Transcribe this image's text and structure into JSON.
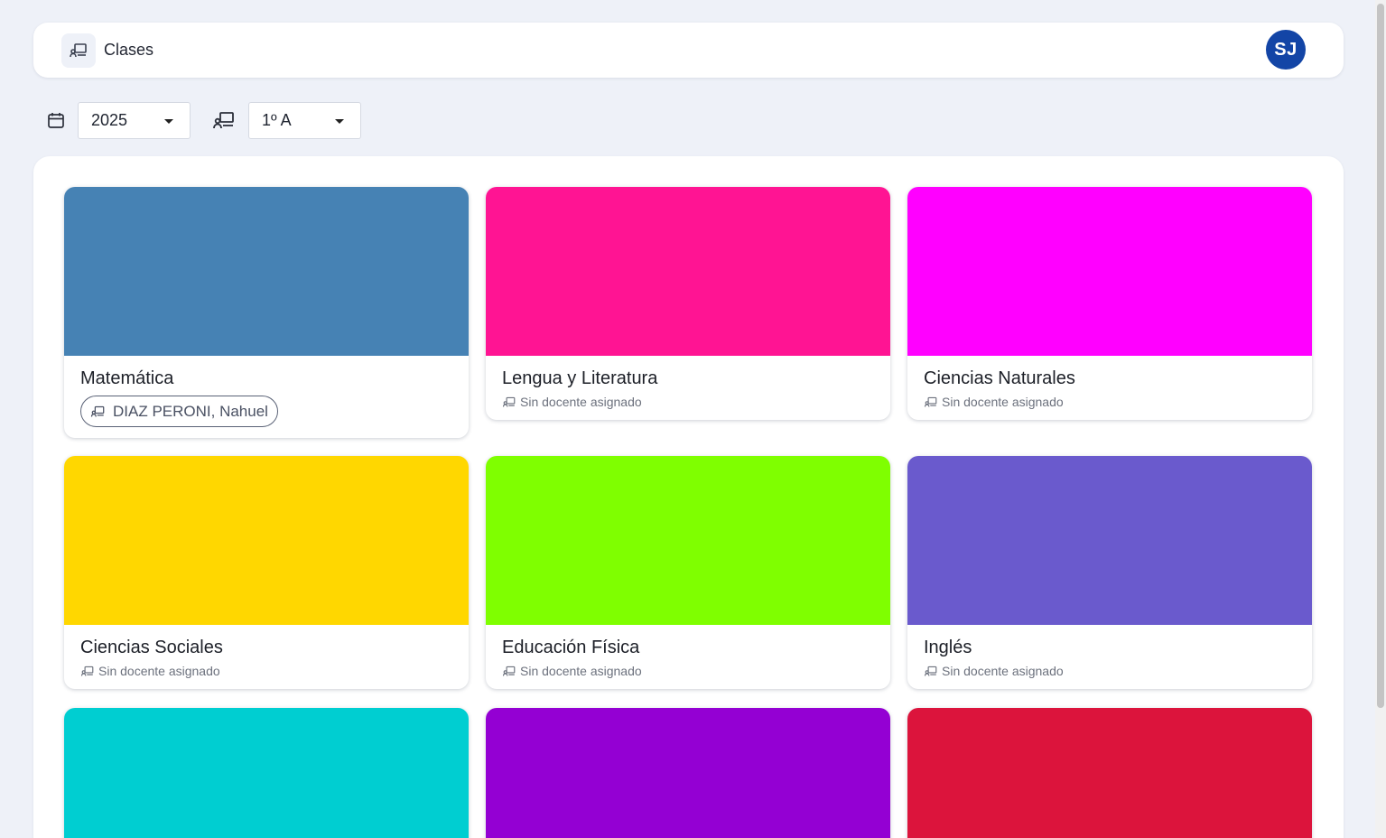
{
  "header": {
    "title": "Clases",
    "icon": "classroom-icon",
    "avatar_initials": "SJ",
    "avatar_color": "#1345a6"
  },
  "filters": {
    "year": {
      "icon": "calendar-icon",
      "value": "2025"
    },
    "division": {
      "icon": "classroom-icon",
      "value": "1º A"
    }
  },
  "classes": [
    {
      "title": "Matemática",
      "color": "#4682b4",
      "teacher": "DIAZ PERONI, Nahuel",
      "assigned": true
    },
    {
      "title": "Lengua y Literatura",
      "color": "#ff1493",
      "teacher": "Sin docente asignado",
      "assigned": false
    },
    {
      "title": "Ciencias Naturales",
      "color": "#ff00ff",
      "teacher": "Sin docente asignado",
      "assigned": false
    },
    {
      "title": "Ciencias Sociales",
      "color": "#ffd700",
      "teacher": "Sin docente asignado",
      "assigned": false
    },
    {
      "title": "Educación Física",
      "color": "#7fff00",
      "teacher": "Sin docente asignado",
      "assigned": false
    },
    {
      "title": "Inglés",
      "color": "#6a5acd",
      "teacher": "Sin docente asignado",
      "assigned": false
    },
    {
      "color": "#00ced1"
    },
    {
      "color": "#9400d3"
    },
    {
      "color": "#dc143c"
    }
  ]
}
